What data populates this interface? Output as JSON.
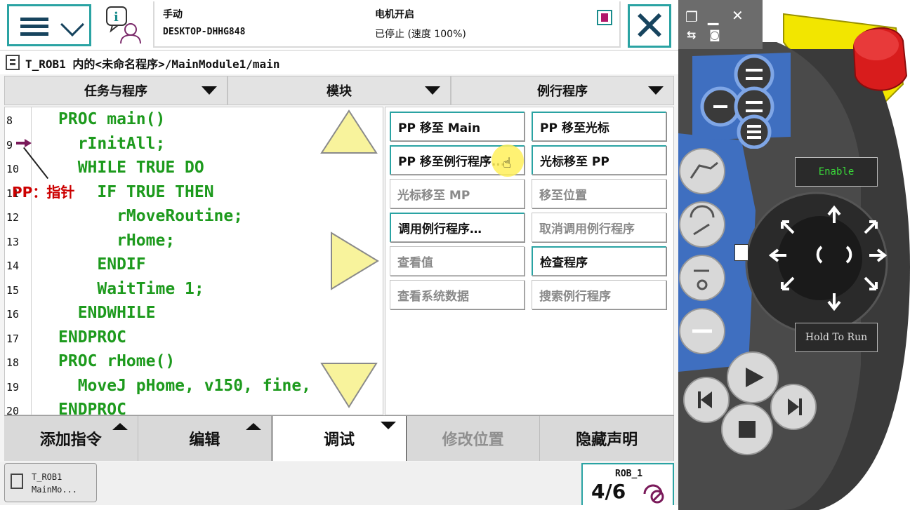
{
  "topbar": {
    "mode": "手动",
    "hostname": "DESKTOP-DHHG848",
    "motor_status": "电机开启",
    "run_status": "已停止 (速度 100%)"
  },
  "breadcrumb": "T_ROB1 内的<未命名程序>/MainModule1/main",
  "tabs": [
    {
      "label": "任务与程序"
    },
    {
      "label": "模块"
    },
    {
      "label": "例行程序"
    }
  ],
  "code": {
    "line_numbers": [
      "8",
      "9",
      "10",
      "11",
      "12",
      "13",
      "14",
      "15",
      "16",
      "17",
      "18",
      "19",
      "20"
    ],
    "lines": [
      "PROC main()",
      "  rInitAll;",
      "  WHILE TRUE DO",
      "    IF TRUE THEN",
      "      rMoveRoutine;",
      "      rHome;",
      "    ENDIF",
      "    WaitTime 1;",
      "  ENDWHILE",
      "ENDPROC",
      "PROC rHome()",
      "  MoveJ pHome, v150, fine,",
      "ENDPROC"
    ],
    "pp_annotation": "PP：指针"
  },
  "menu": {
    "pp_to_main": "PP 移至 Main",
    "pp_to_cursor": "PP 移至光标",
    "pp_to_routine": "PP 移至例行程序...",
    "cursor_to_pp": "光标移至 PP",
    "cursor_to_mp": "光标移至 MP",
    "go_to_position": "移至位置",
    "call_routine": "调用例行程序…",
    "cancel_call_routine": "取消调用例行程序",
    "view_value": "查看值",
    "check_program": "检查程序",
    "view_system_data": "查看系统数据",
    "search_routine": "搜索例行程序"
  },
  "bottom_tabs": {
    "add_instruction": "添加指令",
    "edit": "编辑",
    "debug": "调试",
    "modify_position": "修改位置",
    "hide_declarations": "隐藏声明"
  },
  "taskbar": {
    "task_line1": "T_ROB1",
    "task_line2": "MainMo...",
    "robot_name": "ROB_1",
    "robot_fraction": "4/6"
  },
  "pendant": {
    "enable_label": "Enable",
    "hold_to_run_label": "Hold To Run"
  },
  "colors": {
    "accent": "#2aa3a3",
    "code_green": "#1d9a1d",
    "annotation_red": "#cc0000",
    "pendant_blue": "#3f6fc0",
    "estop_red": "#d81c1c",
    "estop_yellow": "#f2e600"
  }
}
